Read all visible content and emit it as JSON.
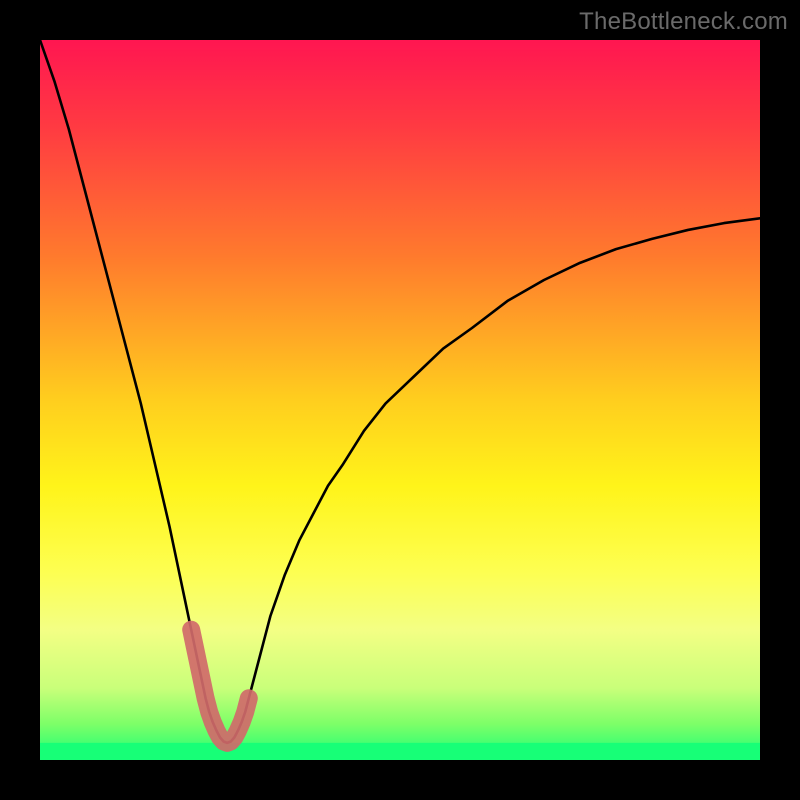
{
  "watermark": "TheBottleneck.com",
  "chart_data": {
    "type": "line",
    "title": "",
    "xlabel": "",
    "ylabel": "",
    "xlim": [
      0,
      100
    ],
    "ylim": [
      0,
      105
    ],
    "curve": {
      "x": [
        0,
        2,
        4,
        6,
        8,
        10,
        12,
        14,
        16,
        18,
        20,
        21,
        22,
        22.5,
        23,
        23.5,
        24,
        24.5,
        25,
        25.5,
        26,
        26.5,
        27,
        27.5,
        28,
        28.5,
        29,
        30,
        31,
        32,
        33,
        34,
        36,
        38,
        40,
        42,
        45,
        48,
        52,
        56,
        60,
        65,
        70,
        75,
        80,
        85,
        90,
        95,
        100
      ],
      "y": [
        105,
        99,
        92,
        84,
        76,
        68,
        60,
        52,
        43,
        34,
        24,
        19,
        14,
        11.5,
        9,
        7,
        5.5,
        4.3,
        3.3,
        2.7,
        2.5,
        2.7,
        3.3,
        4.3,
        5.5,
        7,
        9,
        13,
        17,
        21,
        24,
        27,
        32,
        36,
        40,
        43,
        48,
        52,
        56,
        60,
        63,
        67,
        70,
        72.5,
        74.5,
        76,
        77.3,
        78.3,
        79
      ]
    },
    "highlight_segment": {
      "x": [
        21,
        21.5,
        22,
        22.5,
        23,
        23.5,
        24,
        24.5,
        25,
        25.5,
        26,
        26.5,
        27,
        27.5,
        28,
        28.5,
        29
      ],
      "y": [
        19,
        16.5,
        14,
        11.5,
        9,
        7,
        5.5,
        4.3,
        3.3,
        2.7,
        2.5,
        2.7,
        3.3,
        4.3,
        5.5,
        7,
        9
      ]
    },
    "green_band": {
      "from_y": 0,
      "to_y": 2.5
    },
    "gradient_stops": [
      {
        "offset": 0.0,
        "color": "#ff1651"
      },
      {
        "offset": 0.12,
        "color": "#ff3a42"
      },
      {
        "offset": 0.3,
        "color": "#ff7a2d"
      },
      {
        "offset": 0.5,
        "color": "#ffce1e"
      },
      {
        "offset": 0.62,
        "color": "#fff41a"
      },
      {
        "offset": 0.74,
        "color": "#fdff52"
      },
      {
        "offset": 0.82,
        "color": "#f3ff84"
      },
      {
        "offset": 0.9,
        "color": "#c9ff7a"
      },
      {
        "offset": 0.95,
        "color": "#7dff68"
      },
      {
        "offset": 1.0,
        "color": "#17ff77"
      }
    ]
  }
}
